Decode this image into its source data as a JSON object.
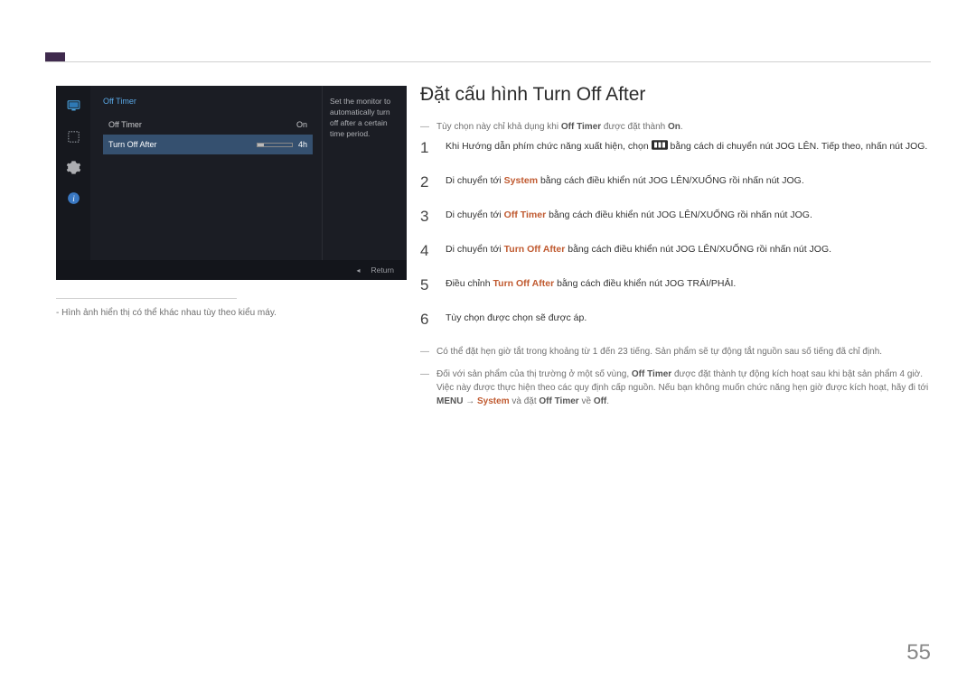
{
  "osd": {
    "title": "Off Timer",
    "rows": {
      "offTimer": {
        "label": "Off Timer",
        "value": "On"
      },
      "turnOffAfter": {
        "label": "Turn Off After",
        "value": "4h"
      }
    },
    "description": "Set the monitor to automatically turn off after a certain time period.",
    "footer_return": "Return"
  },
  "left_note": "Hình ảnh hiển thị có thể khác nhau tùy theo kiểu máy.",
  "title": "Đặt cấu hình Turn Off After",
  "top_note": {
    "pre": "Tùy chọn này chỉ khả dụng khi ",
    "off_timer": "Off Timer",
    "mid": " được đặt thành ",
    "on": "On",
    "post": "."
  },
  "steps": {
    "s1": {
      "pre": "Khi Hướng dẫn phím chức năng xuất hiện, chọn ",
      "mid": " bằng cách di chuyển nút JOG LÊN. Tiếp theo, nhấn nút JOG."
    },
    "s2": {
      "pre": "Di chuyển tới ",
      "system": "System",
      "post": " bằng cách điều khiển nút JOG LÊN/XUỐNG rồi nhấn nút JOG."
    },
    "s3": {
      "pre": "Di chuyển tới ",
      "off_timer": "Off Timer",
      "post": " bằng cách điều khiển nút JOG LÊN/XUỐNG rồi nhấn nút JOG."
    },
    "s4": {
      "pre": "Di chuyển tới ",
      "toa": "Turn Off After",
      "post": " bằng cách điều khiển nút JOG LÊN/XUỐNG rồi nhấn nút JOG."
    },
    "s5": {
      "pre": "Điều chỉnh ",
      "toa": "Turn Off After",
      "post": " bằng cách điều khiển nút JOG TRÁI/PHẢI."
    },
    "s6": "Tùy chọn được chọn sẽ được áp."
  },
  "notes": {
    "n1": "Có thể đặt hẹn giờ tắt trong khoảng từ 1 đến 23 tiếng. Sản phẩm sẽ tự động tắt nguồn sau số tiếng đã chỉ định.",
    "n2": {
      "pre": "Đối với sản phẩm của thị trường ở một số vùng, ",
      "off_timer": "Off Timer",
      "mid1": " được đặt thành tự động kích hoạt sau khi bật sản phẩm 4 giờ. Việc này được thực hiện theo các quy định cấp nguồn. Nếu bạn không muốn chức năng hẹn giờ được kích hoạt, hãy đi tới ",
      "menu": "MENU",
      "arrow": " → ",
      "system": "System",
      "mid2": " và đặt ",
      "off_timer2": "Off Timer",
      "mid3": " về ",
      "off": "Off",
      "post": "."
    }
  },
  "page_number": "55"
}
